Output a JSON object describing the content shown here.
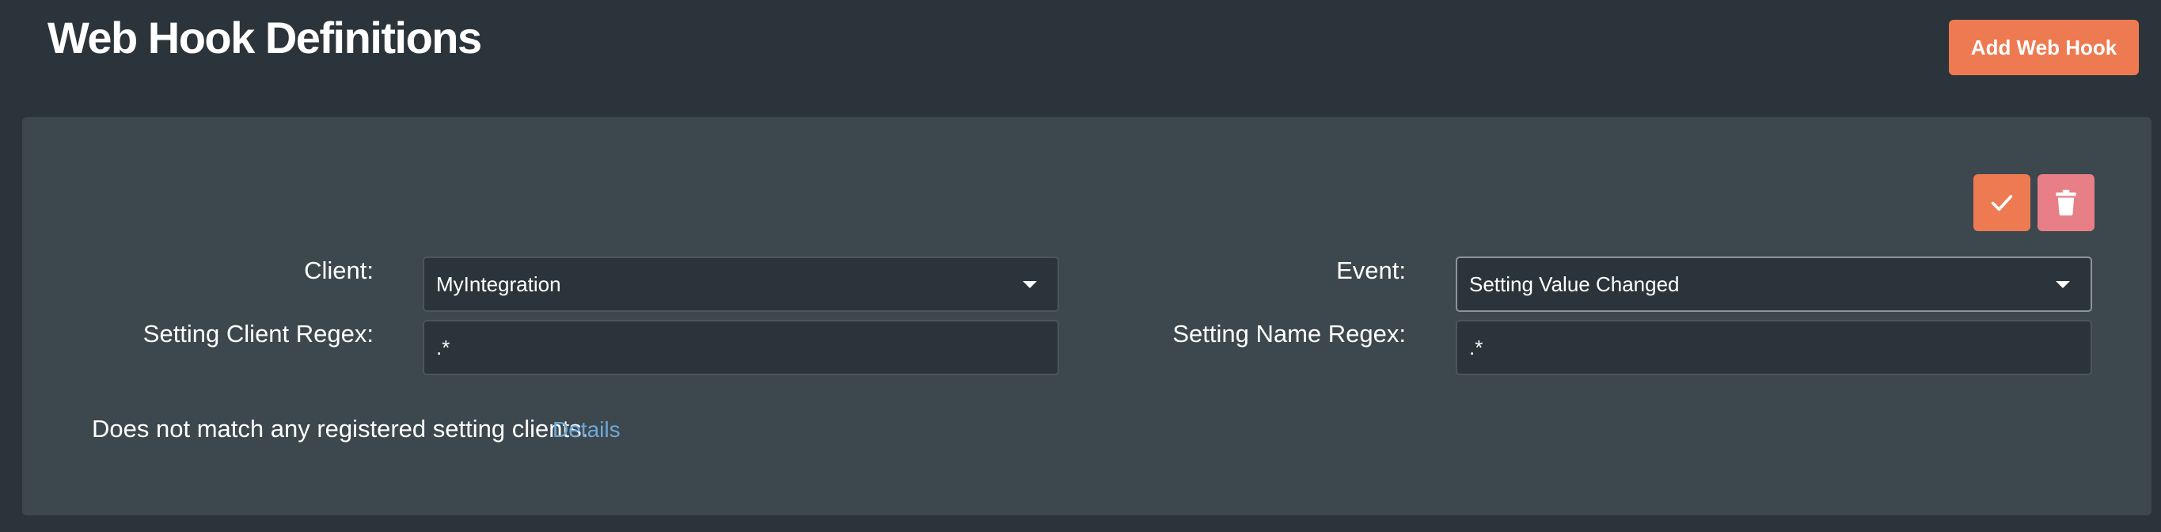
{
  "page": {
    "title": "Web Hook Definitions",
    "add_button_label": "Add Web Hook"
  },
  "webhook": {
    "actions": {
      "save_icon": "checkmark-icon",
      "delete_icon": "trash-icon"
    },
    "client": {
      "label": "Client:",
      "value": "MyIntegration"
    },
    "event": {
      "label": "Event:",
      "value": "Setting Value Changed"
    },
    "client_regex": {
      "label": "Setting Client Regex:",
      "value": ".*"
    },
    "name_regex": {
      "label": "Setting Name Regex:",
      "value": ".*"
    },
    "match_message": "Does not match any registered setting clients.",
    "details_link": "Details"
  },
  "colors": {
    "page_background": "#2b343a",
    "card_background": "#3d474e",
    "accent": "#ee7a52",
    "danger": "#e87e86",
    "link": "#6fa8d6"
  }
}
